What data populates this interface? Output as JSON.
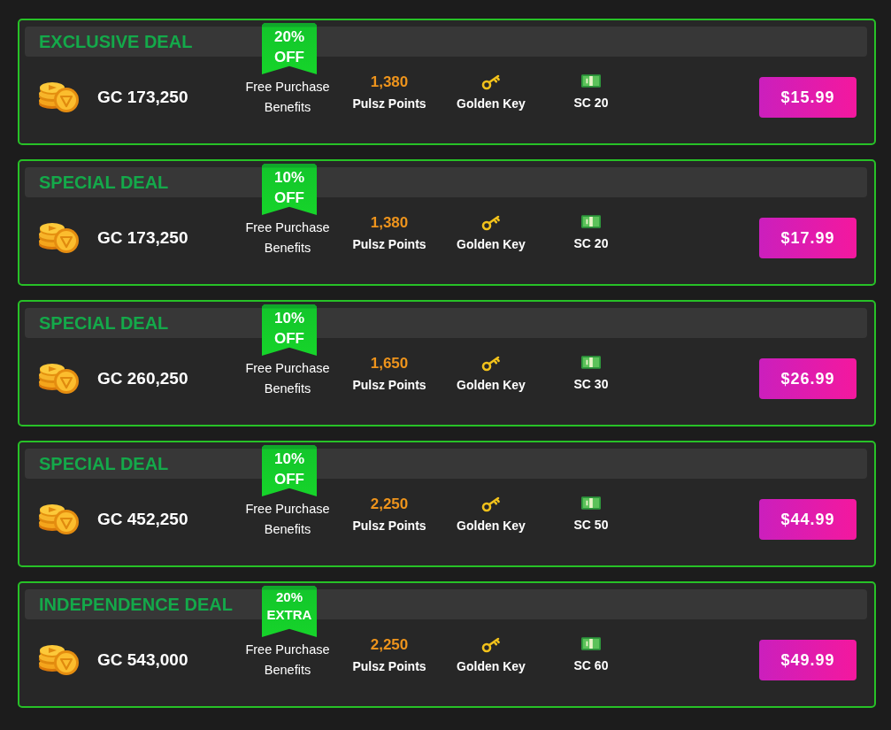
{
  "deals": [
    {
      "title": "EXCLUSIVE DEAL",
      "ribbon": {
        "kind": "off",
        "percent": "20%",
        "label": "OFF"
      },
      "coins": "GC 173,250",
      "benefits": "Free Purchase Benefits",
      "points": {
        "value": "1,380",
        "label": "Pulsz Points"
      },
      "key": "Golden Key",
      "sweeps": "SC 20",
      "price": "$15.99"
    },
    {
      "title": "SPECIAL DEAL",
      "ribbon": {
        "kind": "off",
        "percent": "10%",
        "label": "OFF"
      },
      "coins": "GC 173,250",
      "benefits": "Free Purchase Benefits",
      "points": {
        "value": "1,380",
        "label": "Pulsz Points"
      },
      "key": "Golden Key",
      "sweeps": "SC 20",
      "price": "$17.99"
    },
    {
      "title": "SPECIAL DEAL",
      "ribbon": {
        "kind": "off",
        "percent": "10%",
        "label": "OFF"
      },
      "coins": "GC 260,250",
      "benefits": "Free Purchase Benefits",
      "points": {
        "value": "1,650",
        "label": "Pulsz Points"
      },
      "key": "Golden Key",
      "sweeps": "SC 30",
      "price": "$26.99"
    },
    {
      "title": "SPECIAL DEAL",
      "ribbon": {
        "kind": "off",
        "percent": "10%",
        "label": "OFF"
      },
      "coins": "GC 452,250",
      "benefits": "Free Purchase Benefits",
      "points": {
        "value": "2,250",
        "label": "Pulsz Points"
      },
      "key": "Golden Key",
      "sweeps": "SC 50",
      "price": "$44.99"
    },
    {
      "title": "INDEPENDENCE DEAL",
      "ribbon": {
        "kind": "extra",
        "percent": "20%",
        "label": "EXTRA"
      },
      "coins": "GC 543,000",
      "benefits": "Free Purchase Benefits",
      "points": {
        "value": "2,250",
        "label": "Pulsz Points"
      },
      "key": "Golden Key",
      "sweeps": "SC 60",
      "price": "$49.99"
    }
  ]
}
